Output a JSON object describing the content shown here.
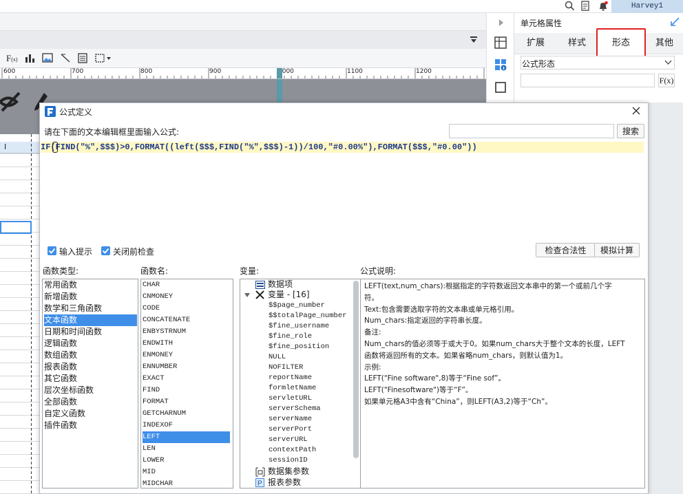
{
  "topbar": {
    "user": "Harvey1",
    "search_icon": "search-icon",
    "doc_icon": "document-icon",
    "bell_icon": "bell-icon"
  },
  "ruler": {
    "ticks": [
      "600",
      "700",
      "800",
      "900",
      "1000",
      "1100",
      "1200"
    ]
  },
  "grid": {
    "column_label": "I"
  },
  "right_panel": {
    "title": "单元格属性",
    "tabs": [
      "扩展",
      "样式",
      "形态",
      "其他"
    ],
    "active_tab": "形态",
    "highlight_color": "#e02020",
    "form_select": "公式形态",
    "fx_label": "F(x)"
  },
  "dialog": {
    "title": "公式定义",
    "prompt": "请在下面的文本编辑框里面输入公式:",
    "search_button": "搜索",
    "formula": "IF(FIND(\"%\",$$$)>0,FORMAT((left($$$,FIND(\"%\",$$$)-1))/100,\"#0.00%\"),FORMAT($$$,\"#0.00\"))",
    "checkbox_hint": "输入提示",
    "checkbox_check": "关闭前检查",
    "validate_button": "检查合法性",
    "simulate_button": "模拟计算",
    "func_type_label": "函数类型:",
    "func_name_label": "函数名:",
    "variables_label": "变量:",
    "desc_label": "公式说明:",
    "func_types": [
      "常用函数",
      "新增函数",
      "数学和三角函数",
      "文本函数",
      "日期和时间函数",
      "逻辑函数",
      "数组函数",
      "报表函数",
      "其它函数",
      "层次坐标函数",
      "全部函数",
      "自定义函数",
      "插件函数"
    ],
    "selected_type": "文本函数",
    "func_names": [
      "CHAR",
      "CNMONEY",
      "CODE",
      "CONCATENATE",
      "ENBYSTRNUM",
      "ENDWITH",
      "ENMONEY",
      "ENNUMBER",
      "EXACT",
      "FIND",
      "FORMAT",
      "GETCHARNUM",
      "INDEXOF",
      "LEFT",
      "LEN",
      "LOWER",
      "MID",
      "MIDCHAR"
    ],
    "selected_func": "LEFT",
    "variables": {
      "data_item": "数据项",
      "group": "变量 - [16]",
      "items": [
        "$$page_number",
        "$$totalPage_number",
        "$fine_username",
        "$fine_role",
        "$fine_position",
        "NULL",
        "NOFILTER",
        "reportName",
        "formletName",
        "servletURL",
        "serverSchema",
        "serverName",
        "serverPort",
        "serverURL",
        "contextPath",
        "sessionID"
      ],
      "dataset_params": "数据集参数",
      "report_params": "报表参数"
    },
    "description": [
      "LEFT(text,num_chars):根据指定的字符数返回文本串中的第一个或前几个字",
      "符。",
      "Text:包含需要选取字符的文本串或单元格引用。",
      "Num_chars:指定返回的字符串长度。",
      "备注:",
      "Num_chars的值必须等于或大于0。如果num_chars大于整个文本的长度，LEFT",
      "函数将返回所有的文本。如果省略num_chars，则默认值为1。",
      "示例:",
      "LEFT(\"Fine software\",8)等于“Fine sof”。",
      "LEFT(\"Finesoftware\")等于“F”。",
      "如果单元格A3中含有“China”，则LEFT(A3,2)等于“Ch”。"
    ]
  }
}
